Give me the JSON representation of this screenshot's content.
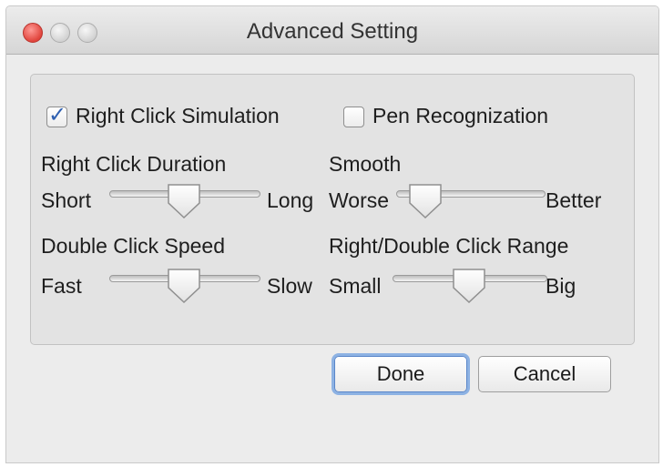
{
  "window": {
    "title": "Advanced Setting"
  },
  "options": {
    "right_click_simulation": {
      "label": "Right Click Simulation",
      "checked": true
    },
    "pen_recognization": {
      "label": "Pen Recognization",
      "checked": false
    }
  },
  "sliders": {
    "right_click_duration": {
      "label": "Right Click Duration",
      "min_label": "Short",
      "max_label": "Long",
      "value": 0.5
    },
    "smooth": {
      "label": "Smooth",
      "min_label": "Worse",
      "max_label": "Better",
      "value": 0.2
    },
    "double_click_speed": {
      "label": "Double Click Speed",
      "min_label": "Fast",
      "max_label": "Slow",
      "value": 0.5
    },
    "click_range": {
      "label": "Right/Double Click Range",
      "min_label": "Small",
      "max_label": "Big",
      "value": 0.5
    }
  },
  "buttons": {
    "done": "Done",
    "cancel": "Cancel"
  }
}
